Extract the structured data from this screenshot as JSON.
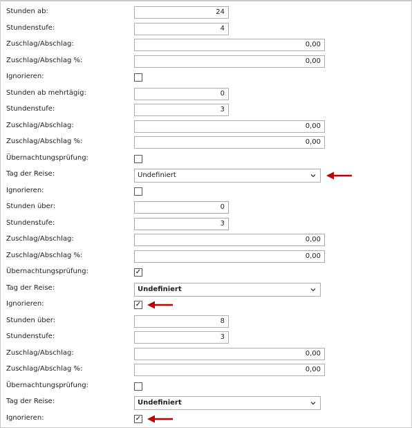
{
  "rows": [
    {
      "label": "Stunden ab:",
      "type": "input",
      "width": "short",
      "value": "24"
    },
    {
      "label": "Stundenstufe:",
      "type": "input",
      "width": "short",
      "value": "4"
    },
    {
      "label": "Zuschlag/Abschlag:",
      "type": "input",
      "width": "long",
      "value": "0,00"
    },
    {
      "label": "Zuschlag/Abschlag %:",
      "type": "input",
      "width": "long",
      "value": "0,00"
    },
    {
      "label": "Ignorieren:",
      "type": "checkbox",
      "checked": false
    },
    {
      "label": "Stunden ab mehrtägig:",
      "type": "input",
      "width": "short",
      "value": "0"
    },
    {
      "label": "Stundenstufe:",
      "type": "input",
      "width": "short",
      "value": "3"
    },
    {
      "label": "Zuschlag/Abschlag:",
      "type": "input",
      "width": "long",
      "value": "0,00"
    },
    {
      "label": "Zuschlag/Abschlag %:",
      "type": "input",
      "width": "long",
      "value": "0,00"
    },
    {
      "label": "Übernachtungsprüfung:",
      "type": "checkbox",
      "checked": false
    },
    {
      "label": "Tag der Reise:",
      "type": "select",
      "value": "Undefiniert",
      "arrow": true
    },
    {
      "label": "Ignorieren:",
      "type": "checkbox",
      "checked": false
    },
    {
      "label": "Stunden über:",
      "type": "input",
      "width": "short",
      "value": "0"
    },
    {
      "label": "Stundenstufe:",
      "type": "input",
      "width": "short",
      "value": "3"
    },
    {
      "label": "Zuschlag/Abschlag:",
      "type": "input",
      "width": "long",
      "value": "0,00"
    },
    {
      "label": "Zuschlag/Abschlag %:",
      "type": "input",
      "width": "long",
      "value": "0,00"
    },
    {
      "label": "Übernachtungsprüfung:",
      "type": "checkbox",
      "checked": true
    },
    {
      "label": "Tag der Reise:",
      "type": "select",
      "value": "Undefiniert",
      "bold": true
    },
    {
      "label": "Ignorieren:",
      "type": "checkbox",
      "checked": true,
      "arrow": true
    },
    {
      "label": "Stunden über:",
      "type": "input",
      "width": "short",
      "value": "8"
    },
    {
      "label": "Stundenstufe:",
      "type": "input",
      "width": "short",
      "value": "3"
    },
    {
      "label": "Zuschlag/Abschlag:",
      "type": "input",
      "width": "long",
      "value": "0,00"
    },
    {
      "label": "Zuschlag/Abschlag %:",
      "type": "input",
      "width": "long",
      "value": "0,00"
    },
    {
      "label": "Übernachtungsprüfung:",
      "type": "checkbox",
      "checked": false
    },
    {
      "label": "Tag der Reise:",
      "type": "select",
      "value": "Undefiniert",
      "bold": true
    },
    {
      "label": "Ignorieren:",
      "type": "checkbox",
      "checked": true,
      "arrow": true
    }
  ],
  "colors": {
    "arrow": "#c00000",
    "border": "#acacac"
  },
  "icons": {
    "checkmark": "✓",
    "dropdown": "chevron-down-icon",
    "annotation": "red-arrow-icon"
  }
}
